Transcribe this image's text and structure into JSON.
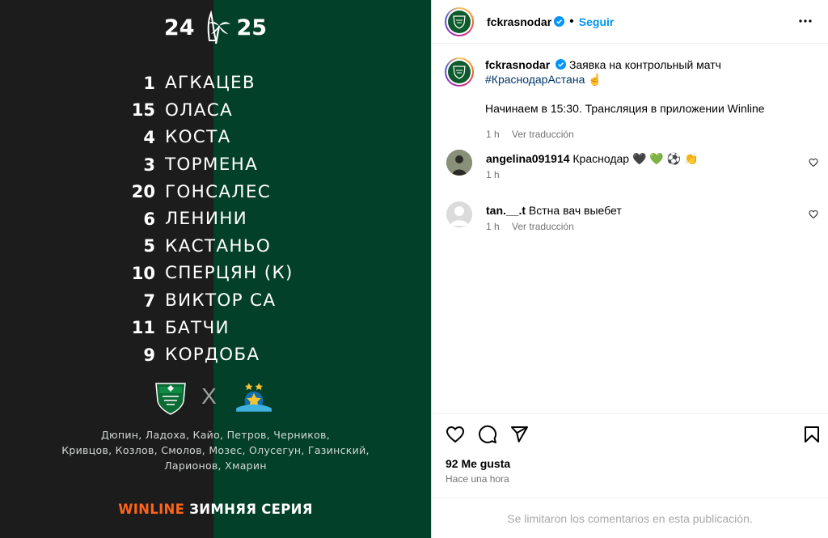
{
  "post_image": {
    "season_left": "24",
    "season_right": "25",
    "lineup": [
      {
        "number": "1",
        "name": "АГКАЦЕВ"
      },
      {
        "number": "15",
        "name": "ОЛАСА"
      },
      {
        "number": "4",
        "name": "КОСТА"
      },
      {
        "number": "3",
        "name": "ТОРМЕНА"
      },
      {
        "number": "20",
        "name": "ГОНСАЛЕС"
      },
      {
        "number": "6",
        "name": "ЛЕНИНИ"
      },
      {
        "number": "5",
        "name": "КАСТАНЬО"
      },
      {
        "number": "10",
        "name": "СПЕРЦЯН (К)"
      },
      {
        "number": "7",
        "name": "ВИКТОР СА"
      },
      {
        "number": "11",
        "name": "БАТЧИ"
      },
      {
        "number": "9",
        "name": "КОРДОБА"
      }
    ],
    "badge_separator": "X",
    "substitutes": [
      "Дюпин, Ладоха, Кайо, Петров, Черников,",
      "Кривцов, Козлов, Смолов, Мозес, Олусегун, Газинский,",
      "Ларионов, Хмарин"
    ],
    "sponsor_brand": "WINLINE",
    "sponsor_series": "ЗИМНЯЯ СЕРИЯ",
    "colors": {
      "left_bg": "#1c1c1c",
      "right_bg": "#03402a",
      "sponsor": "#ff6418"
    }
  },
  "header": {
    "username": "fckrasnodar",
    "separator": "•",
    "follow_label": "Seguir",
    "more_icon": "more-horizontal-icon"
  },
  "caption": {
    "username": "fckrasnodar",
    "text": "Заявка на контрольный матч",
    "hashtag": "#КраснодарАстана",
    "emoji": "☝",
    "body": "Начинаем в 15:30. Трансляция в приложении Winline",
    "time": "1 h",
    "translate": "Ver traducción"
  },
  "comments": [
    {
      "username": "angelina091914",
      "text": "Краснодар",
      "emoji": "🖤 💚 ⚽ 👏",
      "time": "1 h",
      "translate": ""
    },
    {
      "username": "tan.__.t",
      "text": "Встна вач выебет",
      "emoji": "",
      "time": "1 h",
      "translate": "Ver traducción"
    }
  ],
  "actions": {
    "like_icon": "heart-icon",
    "comment_icon": "comment-icon",
    "share_icon": "send-icon",
    "save_icon": "bookmark-icon"
  },
  "likes": "92 Me gusta",
  "posted": "Hace una hora",
  "footer": "Se limitaron los comentarios en esta publicación.",
  "colors": {
    "accent": "#0095f6",
    "verified": "#0095f6",
    "hashtag": "#00376b",
    "muted": "#737373"
  }
}
